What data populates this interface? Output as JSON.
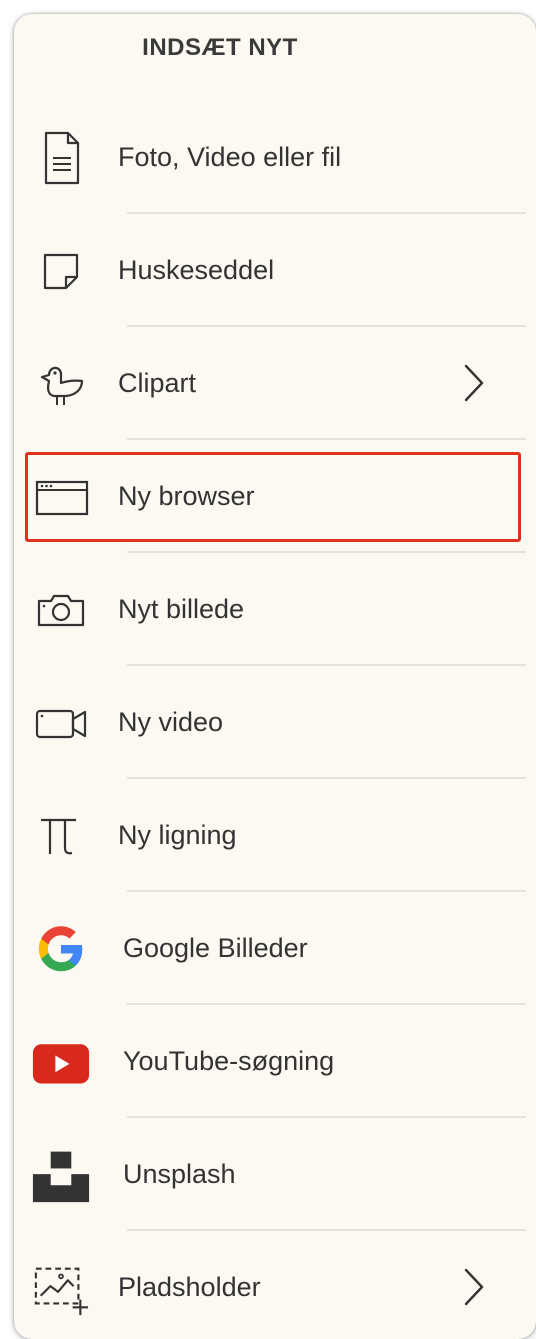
{
  "header": {
    "title": "INDSÆT NYT"
  },
  "menu": {
    "items": [
      {
        "label": "Foto, Video eller fil",
        "icon": "file-icon"
      },
      {
        "label": "Huskeseddel",
        "icon": "sticky-note-icon"
      },
      {
        "label": "Clipart",
        "icon": "bird-clipart-icon",
        "has_submenu": true
      },
      {
        "label": "Ny browser",
        "icon": "browser-window-icon",
        "highlighted": true
      },
      {
        "label": "Nyt billede",
        "icon": "camera-icon"
      },
      {
        "label": "Ny video",
        "icon": "video-camera-icon"
      },
      {
        "label": "Ny ligning",
        "icon": "pi-icon"
      },
      {
        "label": "Google Billeder",
        "icon": "google-icon"
      },
      {
        "label": "YouTube-søgning",
        "icon": "youtube-icon"
      },
      {
        "label": "Unsplash",
        "icon": "unsplash-icon"
      },
      {
        "label": "Pladsholder",
        "icon": "placeholder-image-icon",
        "has_submenu": true
      }
    ]
  },
  "colors": {
    "panel_background": "#fbf9f1",
    "text": "#333333",
    "highlight_border": "#e0311b",
    "youtube_red": "#d9281c",
    "google_blue": "#4285f4",
    "google_red": "#ea4335",
    "google_yellow": "#fbbc05",
    "google_green": "#34a853"
  }
}
